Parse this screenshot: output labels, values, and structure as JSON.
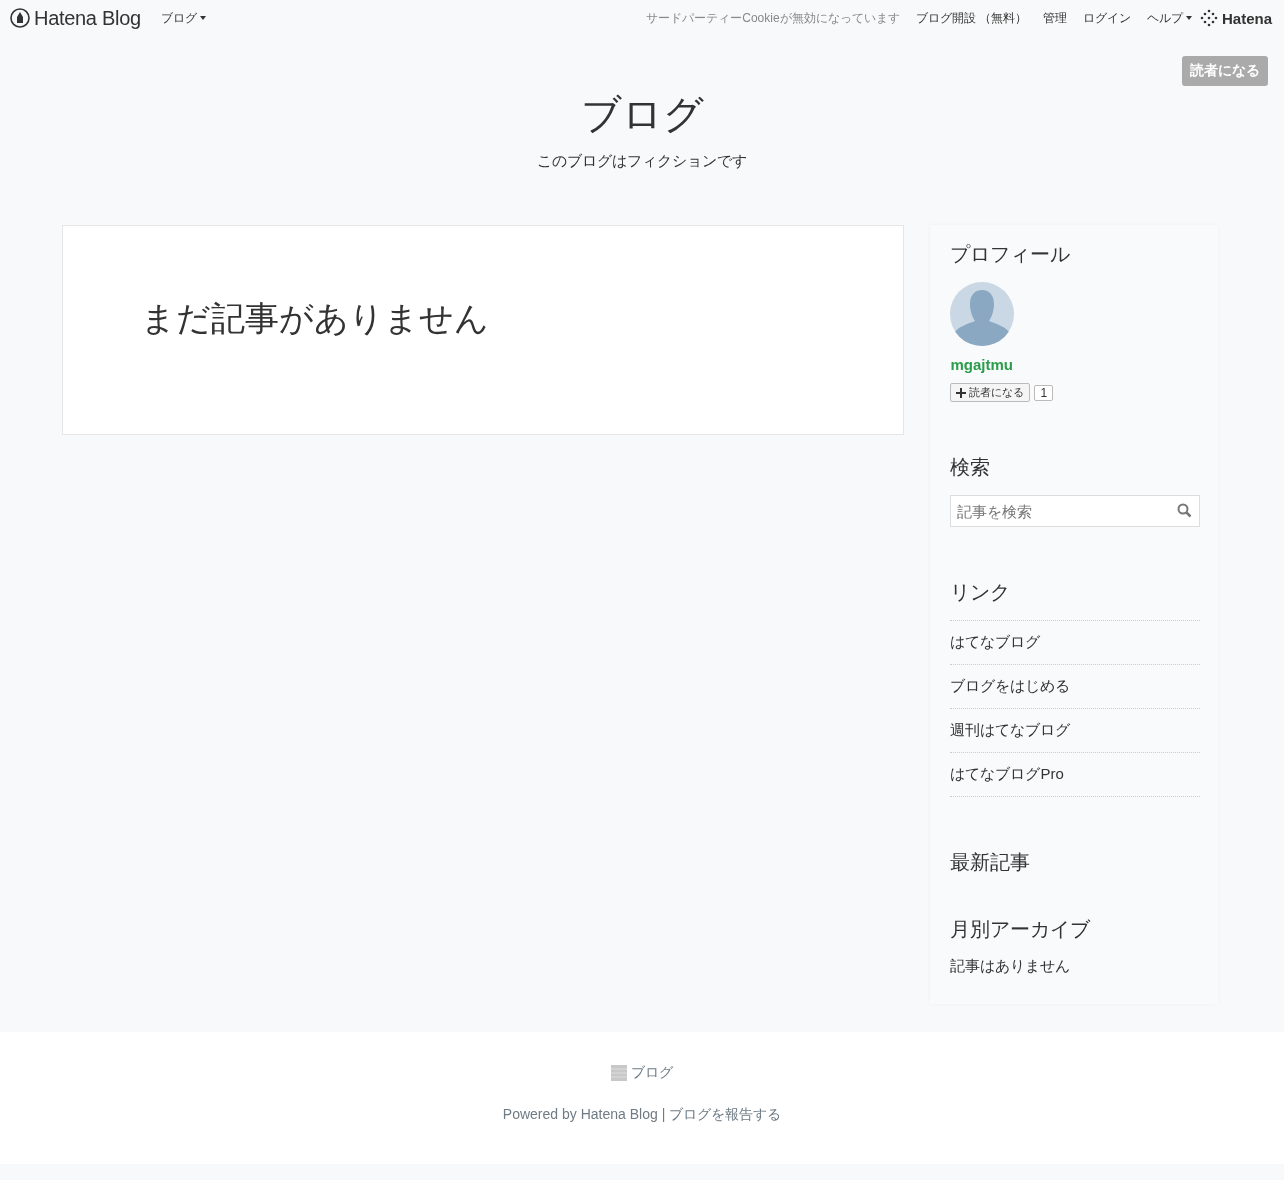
{
  "topbar": {
    "logo": "Hatena Blog",
    "blog_menu": "ブログ",
    "cookie_notice": "サードパーティーCookieが無効になっています",
    "links": [
      "ブログ開設 （無料）",
      "管理",
      "ログイン"
    ],
    "help_menu": "ヘルプ",
    "brand": "Hatena"
  },
  "subscribe_button": "読者になる",
  "header": {
    "title": "ブログ",
    "description": "このブログはフィクションです"
  },
  "main": {
    "empty_message": "まだ記事がありません"
  },
  "sidebar": {
    "profile": {
      "heading": "プロフィール",
      "username": "mgajtmu",
      "subscribe": "読者になる",
      "count": "1"
    },
    "search": {
      "heading": "検索",
      "placeholder": "記事を検索"
    },
    "links": {
      "heading": "リンク",
      "items": [
        "はてなブログ",
        "ブログをはじめる",
        "週刊はてなブログ",
        "はてなブログPro"
      ]
    },
    "recent": {
      "heading": "最新記事"
    },
    "archive": {
      "heading": "月別アーカイブ",
      "empty": "記事はありません"
    }
  },
  "footer": {
    "blog_name": "ブログ",
    "powered_prefix": "Powered by",
    "powered_link": "Hatena Blog",
    "separator": "|",
    "report_link": "ブログを報告する"
  }
}
